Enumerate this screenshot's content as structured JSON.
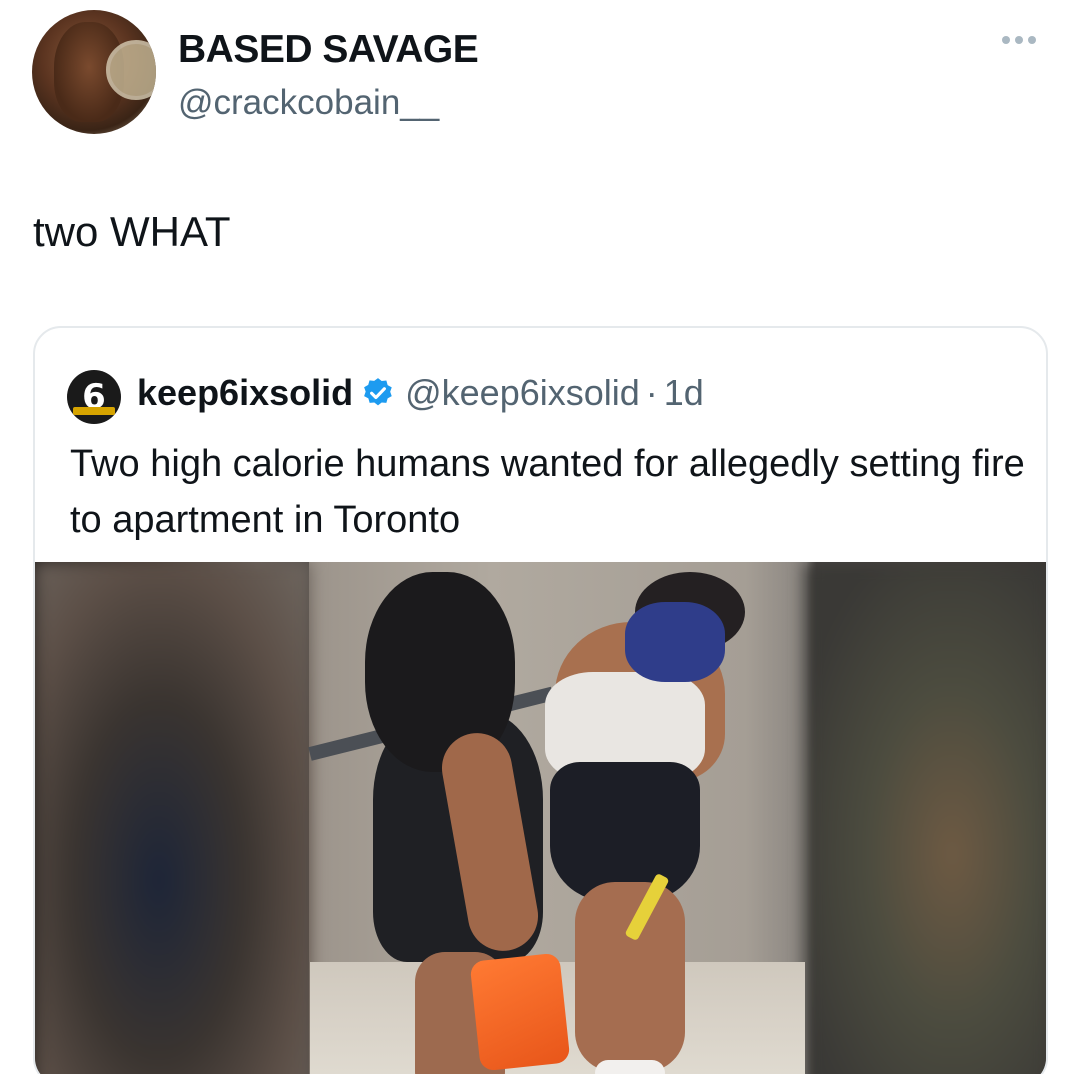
{
  "tweet": {
    "display_name": "BASED SAVAGE",
    "handle": "@crackcobain__",
    "text": "two WHAT",
    "more_icon": "more-horizontal-icon"
  },
  "quoted_tweet": {
    "display_name": "keep6ixsolid",
    "verified_icon": "verified-badge-icon",
    "handle": "@keep6ixsolid",
    "separator": "·",
    "time": "1d",
    "avatar_letter": "6",
    "text": "Two high calorie humans wanted for allegedly setting fire to apartment in Toronto",
    "colors": {
      "verified": "#1d9bf0",
      "secondary_text": "#536471"
    }
  }
}
